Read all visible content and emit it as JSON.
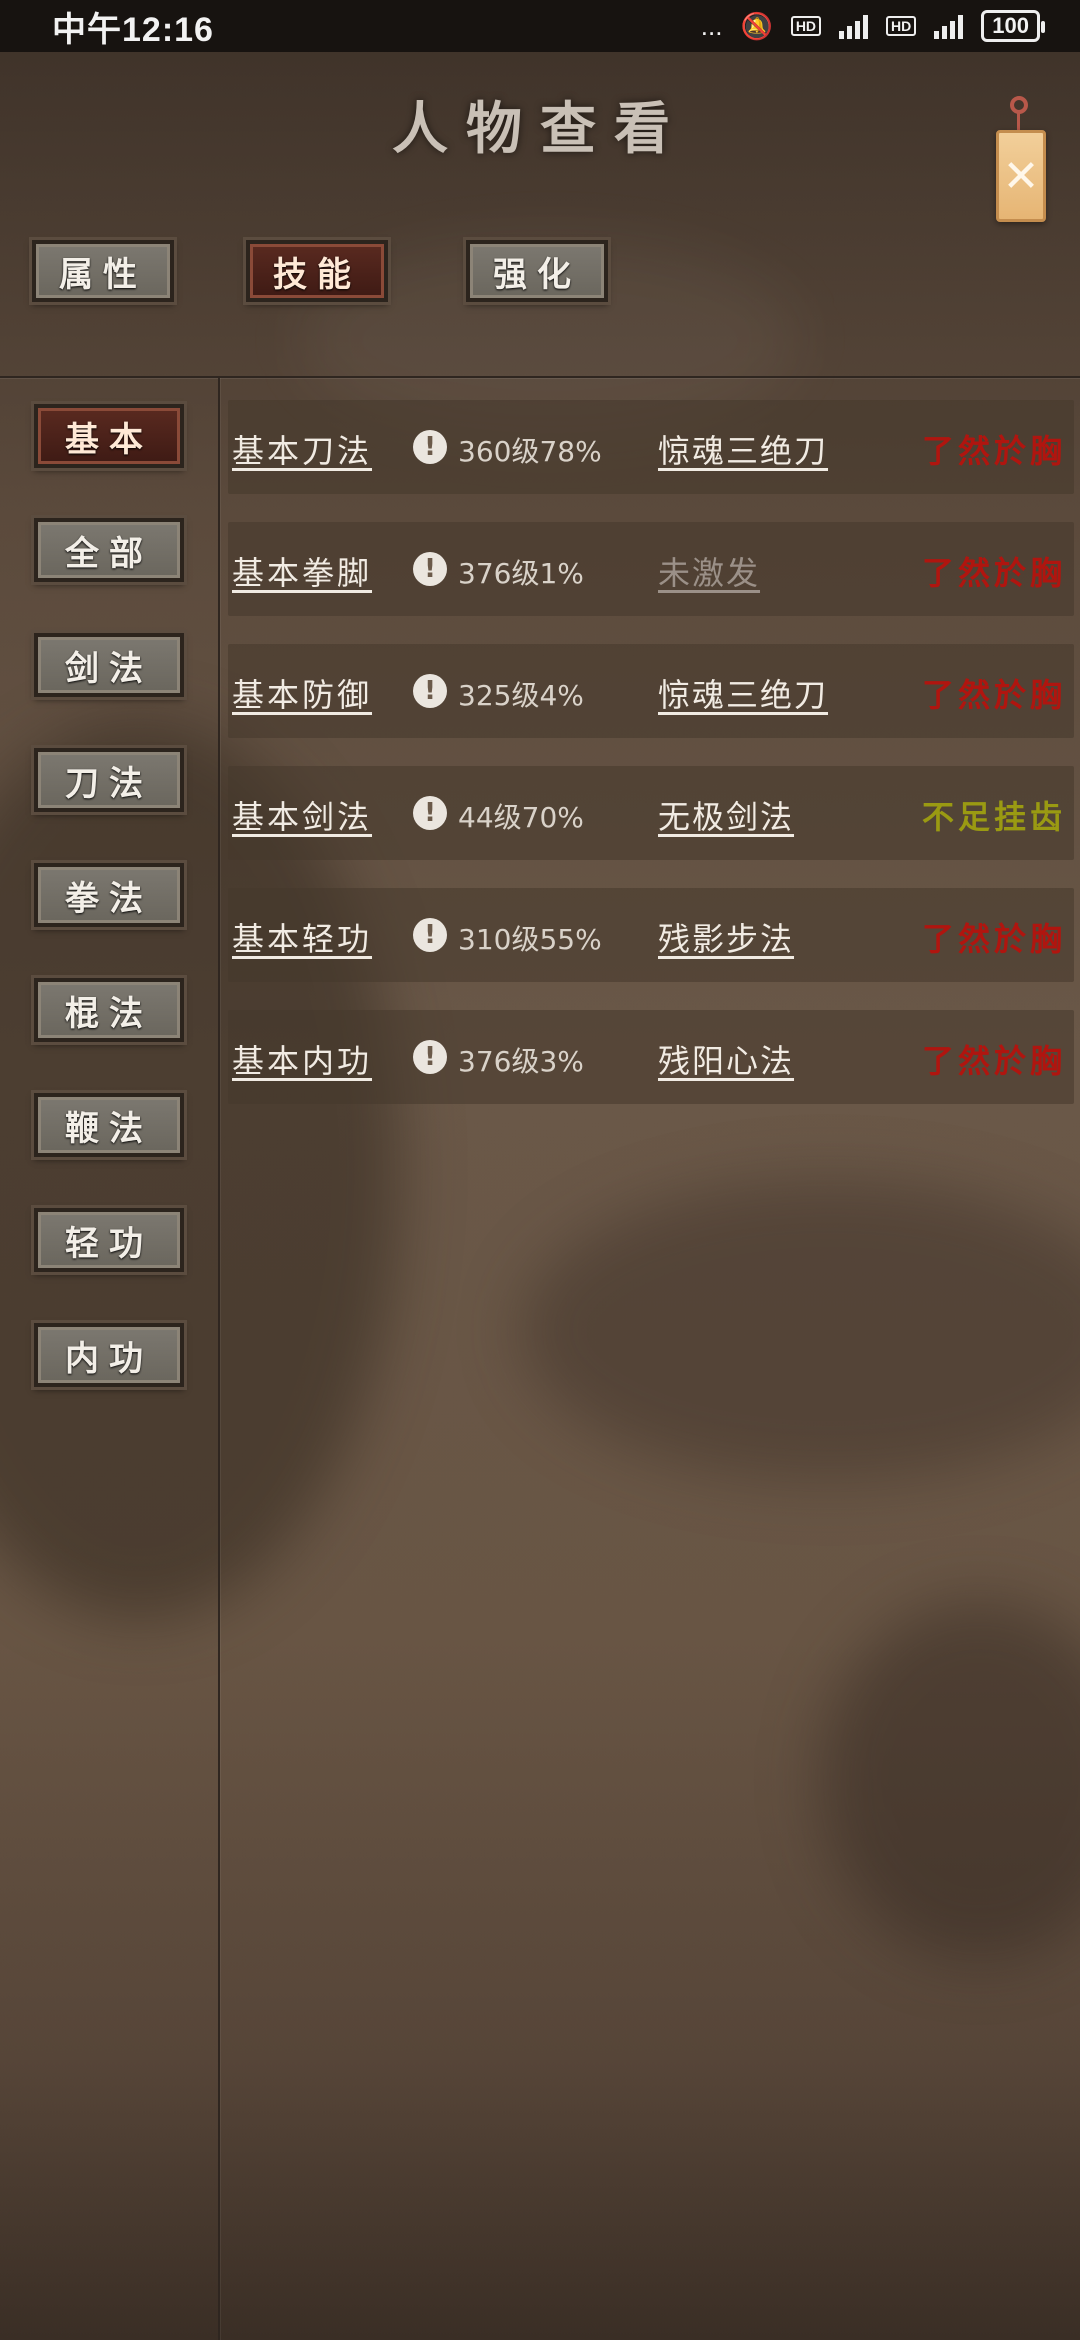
{
  "status_bar": {
    "time": "中午12:16",
    "dots": "...",
    "hd1": "HD",
    "hd2": "HD",
    "battery": "100"
  },
  "header": {
    "title": "人物查看",
    "close_glyph": "✕"
  },
  "tabs": [
    {
      "label": "属性",
      "active": false
    },
    {
      "label": "技能",
      "active": true
    },
    {
      "label": "强化",
      "active": false
    }
  ],
  "sidebar": [
    {
      "label": "基本",
      "active": true
    },
    {
      "label": "全部",
      "active": false
    },
    {
      "label": "剑法",
      "active": false
    },
    {
      "label": "刀法",
      "active": false
    },
    {
      "label": "拳法",
      "active": false
    },
    {
      "label": "棍法",
      "active": false
    },
    {
      "label": "鞭法",
      "active": false
    },
    {
      "label": "轻功",
      "active": false
    },
    {
      "label": "内功",
      "active": false
    }
  ],
  "skills": [
    {
      "name": "基本刀法",
      "level": "360级78%",
      "advanced": "惊魂三绝刀",
      "rank": "了然於胸",
      "rank_color": "#b0150f",
      "inactive": false
    },
    {
      "name": "基本拳脚",
      "level": "376级1%",
      "advanced": "未激发",
      "rank": "了然於胸",
      "rank_color": "#b0150f",
      "inactive": true
    },
    {
      "name": "基本防御",
      "level": "325级4%",
      "advanced": "惊魂三绝刀",
      "rank": "了然於胸",
      "rank_color": "#b0150f",
      "inactive": false
    },
    {
      "name": "基本剑法",
      "level": "44级70%",
      "advanced": "无极剑法",
      "rank": "不足挂齿",
      "rank_color": "#9a9a12",
      "inactive": false
    },
    {
      "name": "基本轻功",
      "level": "310级55%",
      "advanced": "残影步法",
      "rank": "了然於胸",
      "rank_color": "#b0150f",
      "inactive": false
    },
    {
      "name": "基本内功",
      "level": "376级3%",
      "advanced": "残阳心法",
      "rank": "了然於胸",
      "rank_color": "#b0150f",
      "inactive": false
    }
  ],
  "warn_glyph": "!"
}
